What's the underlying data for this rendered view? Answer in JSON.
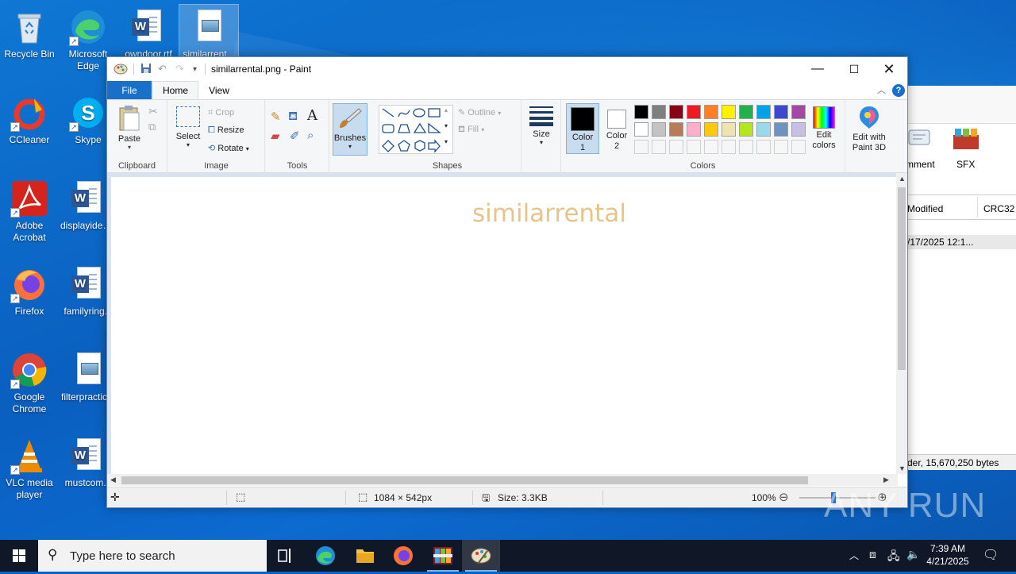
{
  "desktop": {
    "icons": [
      {
        "label": "Recycle Bin"
      },
      {
        "label": "Microsoft Edge"
      },
      {
        "label": "owndoor.rtf"
      },
      {
        "label": "similarrent..."
      },
      {
        "label": "CCleaner"
      },
      {
        "label": "Skype"
      },
      {
        "label": "Adobe Acrobat"
      },
      {
        "label": "displayidea..."
      },
      {
        "label": "Firefox"
      },
      {
        "label": "familyring..."
      },
      {
        "label": "Google Chrome"
      },
      {
        "label": "filterpractic..."
      },
      {
        "label": "VLC media player"
      },
      {
        "label": "mustcom..."
      }
    ]
  },
  "background_window": {
    "toolbar_items": [
      "mment",
      "SFX"
    ],
    "columns": [
      "Modified",
      "CRC32"
    ],
    "row_value": "/17/2025 12:1...",
    "status": "der, 15,670,250 bytes"
  },
  "paint": {
    "title": "similarrental.png - Paint",
    "tabs": {
      "file": "File",
      "home": "Home",
      "view": "View"
    },
    "help": "?",
    "ribbon": {
      "clipboard": {
        "label": "Clipboard",
        "paste": "Paste"
      },
      "image": {
        "label": "Image",
        "select": "Select",
        "crop": "Crop",
        "resize": "Resize",
        "rotate": "Rotate"
      },
      "tools": {
        "label": "Tools"
      },
      "brushes": "Brushes",
      "shapes": {
        "label": "Shapes",
        "outline": "Outline",
        "fill": "Fill"
      },
      "size": "Size",
      "colors": {
        "label": "Colors",
        "color1": "Color 1",
        "color2": "Color 2",
        "edit_colors": "Edit colors",
        "edit_paint3d": "Edit with Paint 3D",
        "color1_value": "#000000",
        "color2_value": "#ffffff",
        "palette_row1": [
          "#000000",
          "#7f7f7f",
          "#880015",
          "#ed1c24",
          "#ff7f27",
          "#fff200",
          "#22b14c",
          "#00a2e8",
          "#3f48cc",
          "#a349a4"
        ],
        "palette_row2": [
          "#ffffff",
          "#c3c3c3",
          "#b97a57",
          "#ffaec9",
          "#ffc90e",
          "#efe4b0",
          "#b5e61d",
          "#99d9ea",
          "#7092be",
          "#c8bfe7"
        ]
      }
    },
    "canvas_text": "similarrental",
    "status": {
      "dimensions": "1084 × 542px",
      "size": "Size: 3.3KB",
      "zoom": "100%"
    }
  },
  "watermark": "ANY RUN",
  "taskbar": {
    "search_placeholder": "Type here to search",
    "time": "7:39 AM",
    "date": "4/21/2025"
  }
}
